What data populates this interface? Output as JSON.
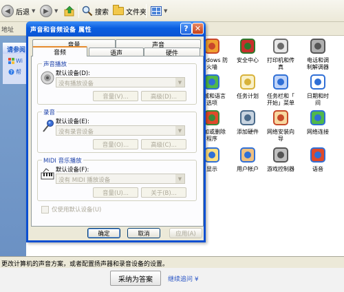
{
  "toolbar": {
    "back_label": "后退",
    "search_label": "搜索",
    "folders_label": "文件夹"
  },
  "address": {
    "label": "地址"
  },
  "left_panel": {
    "title": "请参阅",
    "items": [
      "Wi",
      "帮"
    ]
  },
  "control_panel_items": [
    {
      "label": "Windows 防\n火墙",
      "icon": "firewall-icon"
    },
    {
      "label": "安全中心",
      "icon": "security-center-icon"
    },
    {
      "label": "打印机和传\n真",
      "icon": "printer-icon"
    },
    {
      "label": "电话和调\n制解调器",
      "icon": "phone-modem-icon"
    },
    {
      "label": "区域和语言\n选项",
      "icon": "globe-icon"
    },
    {
      "label": "任务计划",
      "icon": "scheduled-tasks-icon"
    },
    {
      "label": "任务栏和「\n开始」菜单",
      "icon": "taskbar-icon"
    },
    {
      "label": "日期和时\n间",
      "icon": "clock-icon"
    },
    {
      "label": "添加或删除\n程序",
      "icon": "add-remove-programs-icon"
    },
    {
      "label": "添加硬件",
      "icon": "add-hardware-icon"
    },
    {
      "label": "网络安装向\n导",
      "icon": "network-wizard-icon"
    },
    {
      "label": "网络连接",
      "icon": "network-connections-icon"
    },
    {
      "label": "显示",
      "icon": "display-icon"
    },
    {
      "label": "用户帐户",
      "icon": "user-accounts-icon"
    },
    {
      "label": "游戏控制器",
      "icon": "game-controller-icon"
    },
    {
      "label": "语音",
      "icon": "speech-icon"
    }
  ],
  "status_bar": {
    "text": "更改计算机的声音方案，或者配置扬声器和录音设备的设置。"
  },
  "web_strip": {
    "accept_label": "采纳为答案",
    "ask_label": "继续追问 ¥"
  },
  "dialog": {
    "title": "声音和音频设备 属性",
    "tabs_row1": [
      "音量",
      "声音"
    ],
    "tabs_row2": [
      "音频",
      "语声",
      "硬件"
    ],
    "active_tab": "音频",
    "groups": [
      {
        "title": "声音播放",
        "default_label": "默认设备(D):",
        "select_value": "没有播放设备",
        "btn1": "音量(V)...",
        "btn2": "高级(D)..."
      },
      {
        "title": "录音",
        "default_label": "默认设备(E):",
        "select_value": "没有录音设备",
        "btn1": "音量(O)...",
        "btn2": "高级(C)..."
      },
      {
        "title": "MIDI 音乐播放",
        "default_label": "默认设备(F):",
        "select_value": "没有 MIDI 播放设备",
        "btn1": "音量(U)...",
        "btn2": "关于(B)..."
      }
    ],
    "checkbox_label": "仅使用默认设备(U)",
    "buttons": {
      "ok": "确定",
      "cancel": "取消",
      "apply": "应用(A)"
    }
  }
}
